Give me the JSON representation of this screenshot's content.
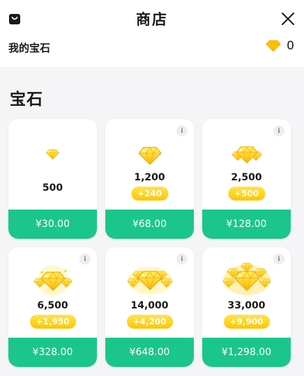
{
  "header": {
    "title": "商店",
    "my_gems_label": "我的宝石",
    "balance": "0",
    "icons": {
      "left": "shopping-bag-icon",
      "close": "close-icon",
      "gem": "diamond-icon"
    }
  },
  "section": {
    "title": "宝石"
  },
  "colors": {
    "price_button": "#1bc68a",
    "bonus_pill": "#ffd21a",
    "gem": "#ffc700"
  },
  "packages": [
    {
      "amount": "500",
      "bonus": null,
      "price": "¥30.00",
      "info_icon": false
    },
    {
      "amount": "1,200",
      "bonus": "+240",
      "price": "¥68.00",
      "info_icon": true
    },
    {
      "amount": "2,500",
      "bonus": "+500",
      "price": "¥128.00",
      "info_icon": true
    },
    {
      "amount": "6,500",
      "bonus": "+1,950",
      "price": "¥328.00",
      "info_icon": true
    },
    {
      "amount": "14,000",
      "bonus": "+4,200",
      "price": "¥648.00",
      "info_icon": true
    },
    {
      "amount": "33,000",
      "bonus": "+9,900",
      "price": "¥1,298.00",
      "info_icon": true
    }
  ]
}
